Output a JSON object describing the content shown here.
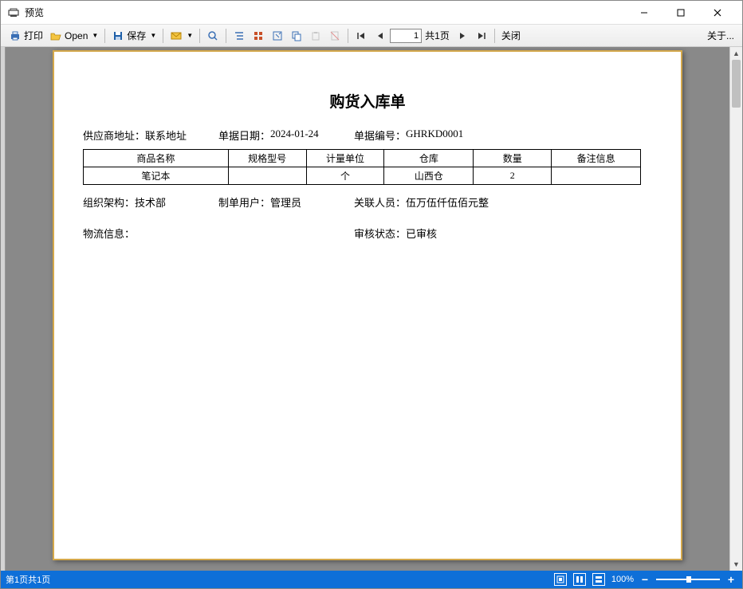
{
  "window": {
    "title": "预览"
  },
  "toolbar": {
    "print": "打印",
    "open": "Open",
    "save": "保存",
    "close": "关闭",
    "about": "关于...",
    "page_input": "1",
    "page_total": "共1页"
  },
  "document": {
    "title": "购货入库单",
    "info1": {
      "supplier_addr_label": "供应商地址：",
      "supplier_addr": "联系地址",
      "doc_date_label": "单据日期：",
      "doc_date": "2024-01-24",
      "doc_no_label": "单据编号：",
      "doc_no": "GHRKD0001"
    },
    "table": {
      "headers": [
        "商品名称",
        "规格型号",
        "计量单位",
        "仓库",
        "数量",
        "备注信息"
      ],
      "rows": [
        [
          "笔记本",
          "",
          "个",
          "山西仓",
          "2",
          ""
        ]
      ]
    },
    "info2": {
      "org_label": "组织架构：",
      "org": "技术部",
      "maker_label": "制单用户：",
      "maker": "管理员",
      "related_label": "关联人员：",
      "related": "伍万伍仟伍佰元整"
    },
    "info3": {
      "logistics_label": "物流信息：",
      "logistics": "",
      "audit_label": "审核状态：",
      "audit": "已审核"
    }
  },
  "statusbar": {
    "page_text": "第1页共1页",
    "zoom": "100%"
  }
}
